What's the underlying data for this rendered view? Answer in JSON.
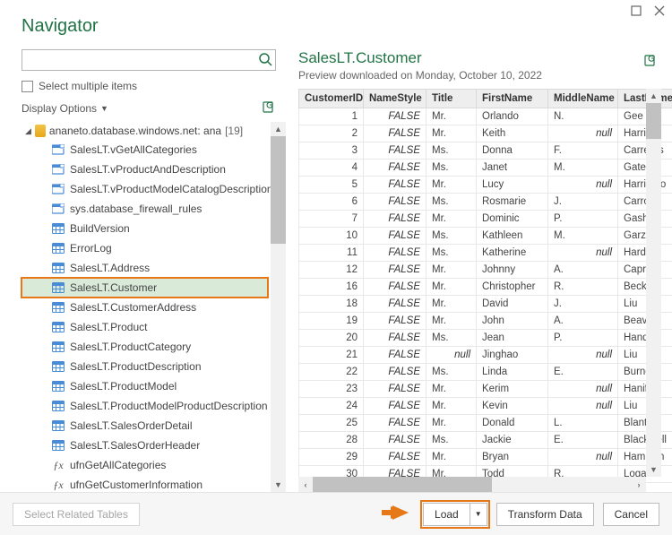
{
  "title": "Navigator",
  "search": {
    "placeholder": ""
  },
  "selectMultiple": "Select multiple items",
  "displayOptions": "Display Options",
  "treeRoot": {
    "label": "ananeto.database.windows.net: ana",
    "count": "[19]"
  },
  "treeItems": [
    {
      "label": "SalesLT.vGetAllCategories",
      "icon": "view"
    },
    {
      "label": "SalesLT.vProductAndDescription",
      "icon": "view"
    },
    {
      "label": "SalesLT.vProductModelCatalogDescription",
      "icon": "view"
    },
    {
      "label": "sys.database_firewall_rules",
      "icon": "view"
    },
    {
      "label": "BuildVersion",
      "icon": "table"
    },
    {
      "label": "ErrorLog",
      "icon": "table"
    },
    {
      "label": "SalesLT.Address",
      "icon": "table"
    },
    {
      "label": "SalesLT.Customer",
      "icon": "table",
      "selected": true
    },
    {
      "label": "SalesLT.CustomerAddress",
      "icon": "table"
    },
    {
      "label": "SalesLT.Product",
      "icon": "table"
    },
    {
      "label": "SalesLT.ProductCategory",
      "icon": "table"
    },
    {
      "label": "SalesLT.ProductDescription",
      "icon": "table"
    },
    {
      "label": "SalesLT.ProductModel",
      "icon": "table"
    },
    {
      "label": "SalesLT.ProductModelProductDescription",
      "icon": "table"
    },
    {
      "label": "SalesLT.SalesOrderDetail",
      "icon": "table"
    },
    {
      "label": "SalesLT.SalesOrderHeader",
      "icon": "table"
    },
    {
      "label": "ufnGetAllCategories",
      "icon": "fx"
    },
    {
      "label": "ufnGetCustomerInformation",
      "icon": "fx"
    }
  ],
  "preview": {
    "title": "SalesLT.Customer",
    "sub": "Preview downloaded on Monday, October 10, 2022"
  },
  "columns": [
    "CustomerID",
    "NameStyle",
    "Title",
    "FirstName",
    "MiddleName",
    "LastName"
  ],
  "rows": [
    {
      "id": "1",
      "ns": "FALSE",
      "title": "Mr.",
      "first": "Orlando",
      "mid": "N.",
      "last": "Gee"
    },
    {
      "id": "2",
      "ns": "FALSE",
      "title": "Mr.",
      "first": "Keith",
      "mid": null,
      "last": "Harris"
    },
    {
      "id": "3",
      "ns": "FALSE",
      "title": "Ms.",
      "first": "Donna",
      "mid": "F.",
      "last": "Carreras"
    },
    {
      "id": "4",
      "ns": "FALSE",
      "title": "Ms.",
      "first": "Janet",
      "mid": "M.",
      "last": "Gates"
    },
    {
      "id": "5",
      "ns": "FALSE",
      "title": "Mr.",
      "first": "Lucy",
      "mid": null,
      "last": "Harringto"
    },
    {
      "id": "6",
      "ns": "FALSE",
      "title": "Ms.",
      "first": "Rosmarie",
      "mid": "J.",
      "last": "Carroll"
    },
    {
      "id": "7",
      "ns": "FALSE",
      "title": "Mr.",
      "first": "Dominic",
      "mid": "P.",
      "last": "Gash"
    },
    {
      "id": "10",
      "ns": "FALSE",
      "title": "Ms.",
      "first": "Kathleen",
      "mid": "M.",
      "last": "Garza"
    },
    {
      "id": "11",
      "ns": "FALSE",
      "title": "Ms.",
      "first": "Katherine",
      "mid": null,
      "last": "Harding"
    },
    {
      "id": "12",
      "ns": "FALSE",
      "title": "Mr.",
      "first": "Johnny",
      "mid": "A.",
      "last": "Caprio"
    },
    {
      "id": "16",
      "ns": "FALSE",
      "title": "Mr.",
      "first": "Christopher",
      "mid": "R.",
      "last": "Beck"
    },
    {
      "id": "18",
      "ns": "FALSE",
      "title": "Mr.",
      "first": "David",
      "mid": "J.",
      "last": "Liu"
    },
    {
      "id": "19",
      "ns": "FALSE",
      "title": "Mr.",
      "first": "John",
      "mid": "A.",
      "last": "Beaver"
    },
    {
      "id": "20",
      "ns": "FALSE",
      "title": "Ms.",
      "first": "Jean",
      "mid": "P.",
      "last": "Handley"
    },
    {
      "id": "21",
      "ns": "FALSE",
      "title": null,
      "first": "Jinghao",
      "mid": null,
      "last": "Liu"
    },
    {
      "id": "22",
      "ns": "FALSE",
      "title": "Ms.",
      "first": "Linda",
      "mid": "E.",
      "last": "Burnett"
    },
    {
      "id": "23",
      "ns": "FALSE",
      "title": "Mr.",
      "first": "Kerim",
      "mid": null,
      "last": "Hanif"
    },
    {
      "id": "24",
      "ns": "FALSE",
      "title": "Mr.",
      "first": "Kevin",
      "mid": null,
      "last": "Liu"
    },
    {
      "id": "25",
      "ns": "FALSE",
      "title": "Mr.",
      "first": "Donald",
      "mid": "L.",
      "last": "Blanton"
    },
    {
      "id": "28",
      "ns": "FALSE",
      "title": "Ms.",
      "first": "Jackie",
      "mid": "E.",
      "last": "Blackwell"
    },
    {
      "id": "29",
      "ns": "FALSE",
      "title": "Mr.",
      "first": "Bryan",
      "mid": null,
      "last": "Hamilton"
    },
    {
      "id": "30",
      "ns": "FALSE",
      "title": "Mr.",
      "first": "Todd",
      "mid": "R.",
      "last": "Logan"
    }
  ],
  "nullText": "null",
  "footer": {
    "selectRelated": "Select Related Tables",
    "load": "Load",
    "transform": "Transform Data",
    "cancel": "Cancel"
  }
}
